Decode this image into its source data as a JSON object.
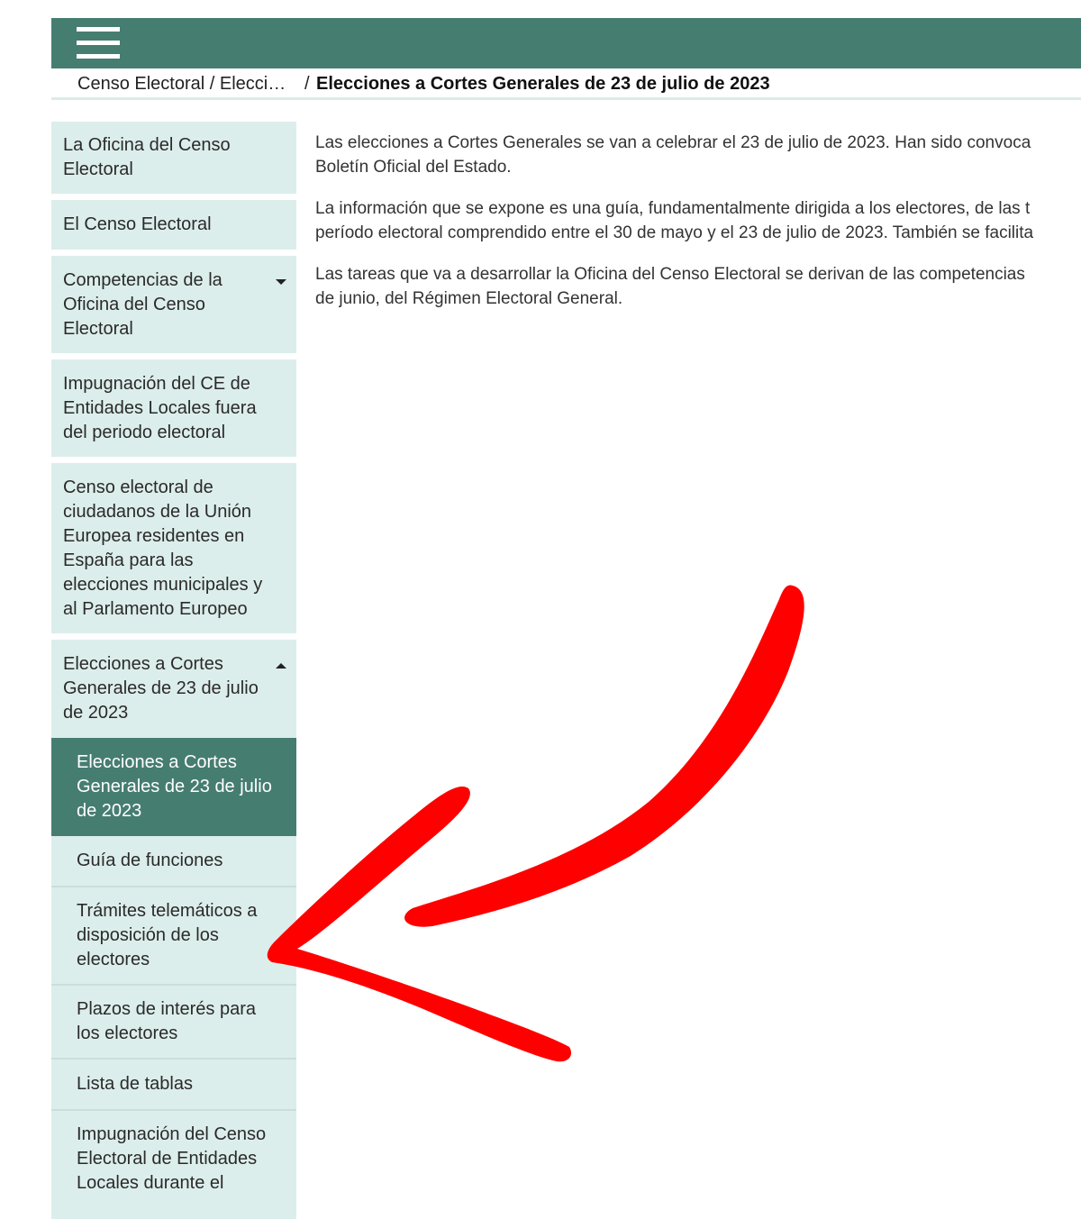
{
  "header": {
    "menu_icon": "hamburger-menu-icon",
    "color": "#467d71"
  },
  "breadcrumb": {
    "link": "Censo Electoral / Elecci…",
    "separator": "/",
    "current": "Elecciones a Cortes Generales de 23 de julio de 2023"
  },
  "sidebar": {
    "items": [
      {
        "label": "La Oficina del Censo Electoral"
      },
      {
        "label": "El Censo Electoral"
      },
      {
        "label": "Competencias de la Oficina del Censo Electoral",
        "caret": "down"
      },
      {
        "label": "Impugnación del CE de Entidades Locales fuera del periodo electoral"
      },
      {
        "label": "Censo electoral de ciudadanos de la Unión Europea residentes en España para las elecciones municipales y al Parlamento Europeo"
      },
      {
        "label": "Elecciones a Cortes Generales de 23 de julio de 2023",
        "caret": "up"
      }
    ],
    "subitems": [
      {
        "label": "Elecciones a Cortes Generales de 23 de julio de 2023",
        "active": true
      },
      {
        "label": "Guía de funciones"
      },
      {
        "label": "Trámites telemáticos a disposición de los electores"
      },
      {
        "label": "Plazos de interés para los electores"
      },
      {
        "label": "Lista de tablas"
      },
      {
        "label": "Impugnación del Censo Electoral de Entidades Locales durante el"
      }
    ]
  },
  "content": {
    "paragraphs": [
      {
        "line1": "Las elecciones a Cortes Generales se van a celebrar el 23 de julio de 2023. Han sido convoca",
        "line2": "Boletín Oficial del Estado."
      },
      {
        "line1": "La información que se expone es una guía, fundamentalmente dirigida a los electores, de las t",
        "line2": "período electoral comprendido entre el 30 de mayo y el 23 de julio de 2023. También se facilita"
      },
      {
        "line1": "Las tareas que va a desarrollar la Oficina del Censo Electoral se derivan de las competencias",
        "line2": "de junio, del Régimen Electoral General."
      }
    ]
  },
  "annotation": {
    "arrow_color": "#ff0000"
  }
}
